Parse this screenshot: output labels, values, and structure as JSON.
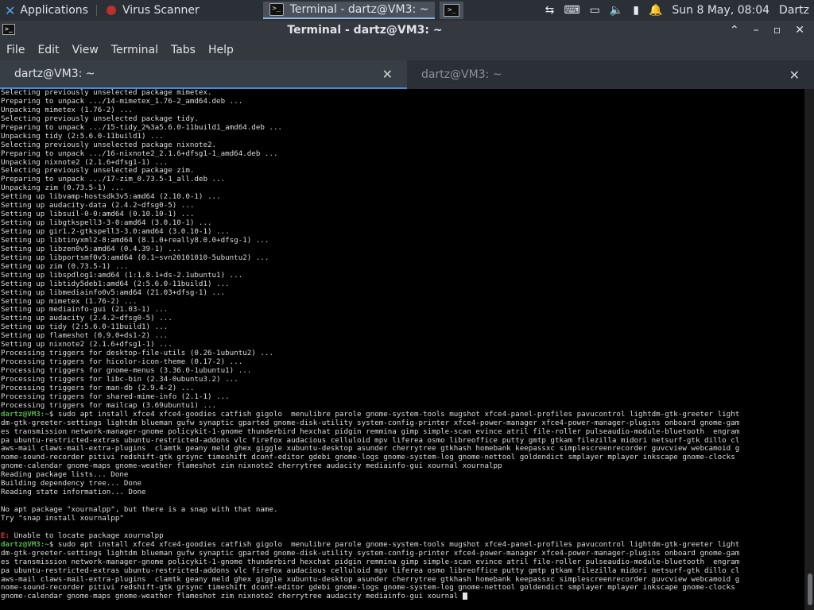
{
  "panel": {
    "applications": "Applications",
    "tasks": [
      {
        "label": "Virus Scanner",
        "icon": "virus-scanner-icon",
        "active": false
      },
      {
        "label": "Terminal - dartz@VM3: ~",
        "icon": "terminal-icon",
        "active": true
      }
    ],
    "clock": "Sun  8 May, 08:04",
    "user": "Dartz"
  },
  "window": {
    "title": "Terminal - dartz@VM3: ~",
    "menu": [
      "File",
      "Edit",
      "View",
      "Terminal",
      "Tabs",
      "Help"
    ],
    "tabs": [
      {
        "label": "dartz@VM3: ~",
        "active": true
      },
      {
        "label": "dartz@VM3: ~",
        "active": false
      }
    ]
  },
  "terminal": {
    "prompt": "dartz@VM3:~",
    "lines": [
      "Selecting previously unselected package mimetex.",
      "Preparing to unpack .../14-mimetex_1.76-2_amd64.deb ...",
      "Unpacking mimetex (1.76-2) ...",
      "Selecting previously unselected package tidy.",
      "Preparing to unpack .../15-tidy_2%3a5.6.0-11build1_amd64.deb ...",
      "Unpacking tidy (2:5.6.0-11build1) ...",
      "Selecting previously unselected package nixnote2.",
      "Preparing to unpack .../16-nixnote2_2.1.6+dfsg1-1_amd64.deb ...",
      "Unpacking nixnote2 (2.1.6+dfsg1-1) ...",
      "Selecting previously unselected package zim.",
      "Preparing to unpack .../17-zim_0.73.5-1_all.deb ...",
      "Unpacking zim (0.73.5-1) ...",
      "Setting up libvamp-hostsdk3v5:amd64 (2.10.0-1) ...",
      "Setting up audacity-data (2.4.2~dfsg0-5) ...",
      "Setting up libsuil-0-0:amd64 (0.10.10-1) ...",
      "Setting up libgtkspell3-3-0:amd64 (3.0.10-1) ...",
      "Setting up gir1.2-gtkspell3-3.0:amd64 (3.0.10-1) ...",
      "Setting up libtinyxml2-8:amd64 (8.1.0+really8.0.0+dfsg-1) ...",
      "Setting up libzen0v5:amd64 (0.4.39-1) ...",
      "Setting up libportsmf0v5:amd64 (0.1~svn20101010-5ubuntu2) ...",
      "Setting up zim (0.73.5-1) ...",
      "Setting up libspdlog1:amd64 (1:1.8.1+ds-2.1ubuntu1) ...",
      "Setting up libtidy5deb1:amd64 (2:5.6.0-11build1) ...",
      "Setting up libmediainfo0v5:amd64 (21.03+dfsg-1) ...",
      "Setting up mimetex (1.76-2) ...",
      "Setting up mediainfo-gui (21.03-1) ...",
      "Setting up audacity (2.4.2~dfsg0-5) ...",
      "Setting up tidy (2:5.6.0-11build1) ...",
      "Setting up flameshot (0.9.0+ds1-2) ...",
      "Setting up nixnote2 (2.1.6+dfsg1-1) ...",
      "Processing triggers for desktop-file-utils (0.26-1ubuntu2) ...",
      "Processing triggers for hicolor-icon-theme (0.17-2) ...",
      "Processing triggers for gnome-menus (3.36.0-1ubuntu1) ...",
      "Processing triggers for libc-bin (2.34-0ubuntu3.2) ...",
      "Processing triggers for man-db (2.9.4-2) ...",
      "Processing triggers for shared-mime-info (2.1-1) ...",
      "Processing triggers for mailcap (3.69ubuntu1) ..."
    ],
    "cmd1": [
      "$ sudo apt install xfce4 xfce4-goodies catfish gigolo  menulibre parole gnome-system-tools mugshot xfce4-panel-profiles pavucontrol lightdm-gtk-greeter light",
      "dm-gtk-greeter-settings lightdm blueman gufw synaptic gparted gnome-disk-utility system-config-printer xfce4-power-manager xfce4-power-manager-plugins onboard gnome-gam",
      "es transmission network-manager-gnome policykit-1-gnome thunderbird hexchat pidgin remmina gimp simple-scan evince atril file-roller pulseaudio-module-bluetooth  engram",
      "pa ubuntu-restricted-extras ubuntu-restricted-addons vlc firefox audacious celluloid mpv liferea osmo libreoffice putty gmtp gtkam filezilla midori netsurf-gtk dillo cl",
      "aws-mail claws-mail-extra-plugins  clamtk geany meld ghex giggle xubuntu-desktop asunder cherrytree gtkhash homebank keepassxc simplescreenrecorder guvcview webcamoid g",
      "nome-sound-recorder pitivi redshift-gtk grsync timeshift dconf-editor gdebi gnome-logs gnome-system-log gnome-nettool goldendict smplayer mplayer inkscape gnome-clocks",
      "gnome-calendar gnome-maps gnome-weather flameshot zim nixnote2 cherrytree audacity mediainfo-gui xournal xournalpp"
    ],
    "output2": [
      "Reading package lists... Done",
      "Building dependency tree... Done",
      "Reading state information... Done",
      "",
      "No apt package \"xournalpp\", but there is a snap with that name.",
      "Try \"snap install xournalpp\"",
      ""
    ],
    "error_prefix": "E:",
    "error_text": " Unable to locate package xournalpp",
    "cmd2": [
      "$ sudo apt install xfce4 xfce4-goodies catfish gigolo  menulibre parole gnome-system-tools mugshot xfce4-panel-profiles pavucontrol lightdm-gtk-greeter light",
      "dm-gtk-greeter-settings lightdm blueman gufw synaptic gparted gnome-disk-utility system-config-printer xfce4-power-manager xfce4-power-manager-plugins onboard gnome-gam",
      "es transmission network-manager-gnome policykit-1-gnome thunderbird hexchat pidgin remmina gimp simple-scan evince atril file-roller pulseaudio-module-bluetooth  engram",
      "pa ubuntu-restricted-extras ubuntu-restricted-addons vlc firefox audacious celluloid mpv liferea osmo libreoffice putty gmtp gtkam filezilla midori netsurf-gtk dillo cl",
      "aws-mail claws-mail-extra-plugins  clamtk geany meld ghex giggle xubuntu-desktop asunder cherrytree gtkhash homebank keepassxc simplescreenrecorder guvcview webcamoid g",
      "nome-sound-recorder pitivi redshift-gtk grsync timeshift dconf-editor gdebi gnome-logs gnome-system-log gnome-nettool goldendict smplayer mplayer inkscape gnome-clocks",
      "gnome-calendar gnome-maps gnome-weather flameshot zim nixnote2 cherrytree audacity mediainfo-gui xournal "
    ]
  }
}
